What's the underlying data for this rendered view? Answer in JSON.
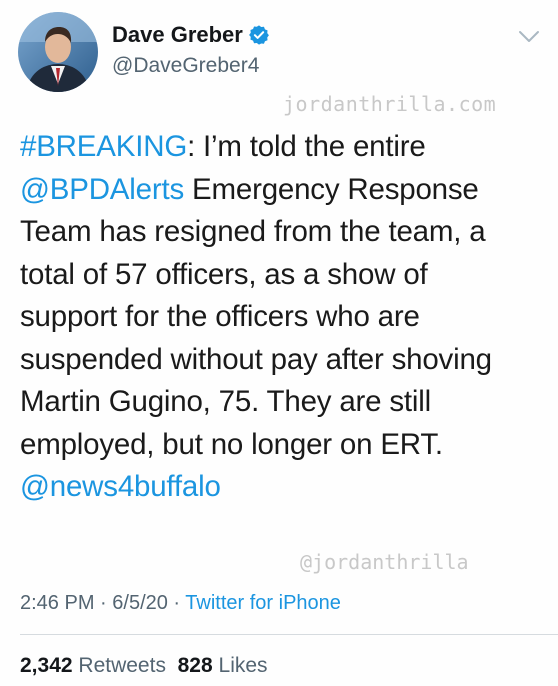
{
  "user": {
    "display_name": "Dave Greber",
    "handle": "@DaveGreber4",
    "verified": true
  },
  "watermarks": [
    "jordanthrilla.com",
    "@jordanthrilla"
  ],
  "tweet": {
    "line1": {
      "hashtag": "#BREAKING",
      "text": ": I’m told the entire"
    },
    "line2": {
      "mention": "@BPDAlerts",
      "text": " Emergency Response"
    },
    "line3": "Team has resigned from the team, a",
    "line4": "total of 57 officers, as a show of",
    "line5": "support for the officers who are",
    "line6": "suspended without pay after shoving",
    "line7": "Martin Gugino, 75. They are still",
    "line8": "employed, but no longer on ERT.",
    "line9": {
      "mention": "@news4buffalo"
    }
  },
  "meta": {
    "time": "2:46 PM",
    "sep1": " · ",
    "date": "6/5/20",
    "sep2": " · ",
    "source": "Twitter for iPhone"
  },
  "stats": {
    "retweets_count": "2,342",
    "retweets_label": "Retweets",
    "likes_count": "828",
    "likes_label": "Likes"
  },
  "colors": {
    "link": "#1b95e0",
    "text": "#1a1a1a",
    "secondary": "#536471"
  }
}
